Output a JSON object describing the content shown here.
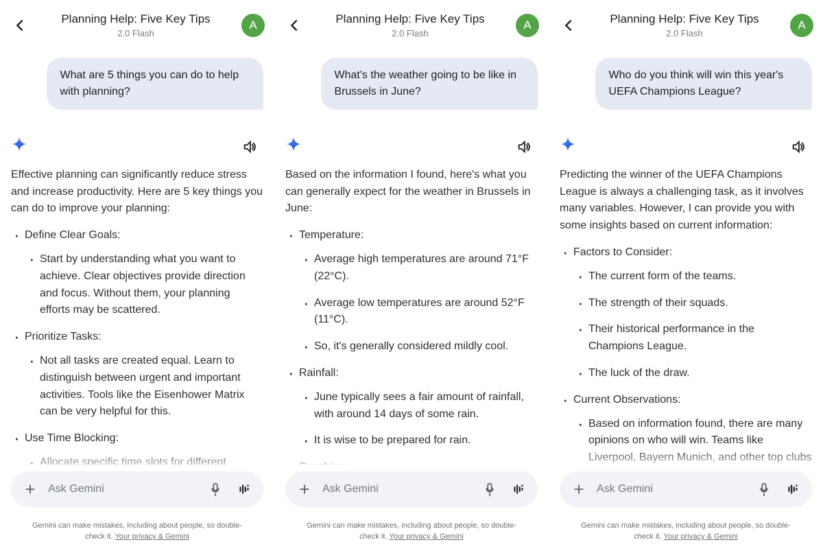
{
  "header": {
    "title": "Planning Help: Five Key Tips",
    "subtitle": "2.0 Flash",
    "avatar_letter": "A"
  },
  "input": {
    "placeholder": "Ask Gemini"
  },
  "disclaimer": {
    "text": "Gemini can make mistakes, including about people, so double-check it.",
    "link": "Your privacy & Gemini"
  },
  "screens": [
    {
      "user": "What are 5 things you can do to help with planning?",
      "intro": "Effective planning can significantly reduce stress and increase productivity. Here are 5 key things you can do to improve your planning:",
      "items": [
        {
          "heading": "Define Clear Goals:",
          "sub": [
            "Start by understanding what you want to achieve. Clear objectives provide direction and focus. Without them, your planning efforts may be scattered."
          ]
        },
        {
          "heading": "Prioritize Tasks:",
          "sub": [
            "Not all tasks are created equal. Learn to distinguish between urgent and important activities. Tools like the Eisenhower Matrix can be very helpful for this."
          ]
        },
        {
          "heading": "Use Time Blocking:",
          "sub": [
            "Allocate specific time slots for different"
          ]
        }
      ]
    },
    {
      "user": "What's the weather going to be like in Brussels in June?",
      "intro": "Based on the information I found, here's what you can generally expect for the weather in Brussels in June:",
      "items": [
        {
          "heading": "Temperature:",
          "sub": [
            "Average high temperatures are around 71°F (22°C).",
            "Average low temperatures are around 52°F (11°C).",
            "So, it's generally considered mildly cool."
          ]
        },
        {
          "heading": "Rainfall:",
          "sub": [
            "June typically sees a fair amount of rainfall, with around 14 days of some rain.",
            "It is wise to be prepared for rain."
          ]
        },
        {
          "heading": "Sunshine:",
          "sub": []
        }
      ]
    },
    {
      "user": "Who do you think will win this year's UEFA Champions League?",
      "intro": "Predicting the winner of the UEFA Champions League is always a challenging task, as it involves many variables. However, I can provide you with some insights based on current information:",
      "items": [
        {
          "heading": "Factors to Consider:",
          "sub": [
            "The current form of the teams.",
            "The strength of their squads.",
            "Their historical performance in the Champions League.",
            "The luck of the draw."
          ]
        },
        {
          "heading": "Current Observations:",
          "sub": [
            "Based on information found, there are many opinions on who will win. Teams like Liverpool, Bayern Munich, and other top clubs are"
          ]
        }
      ]
    }
  ]
}
